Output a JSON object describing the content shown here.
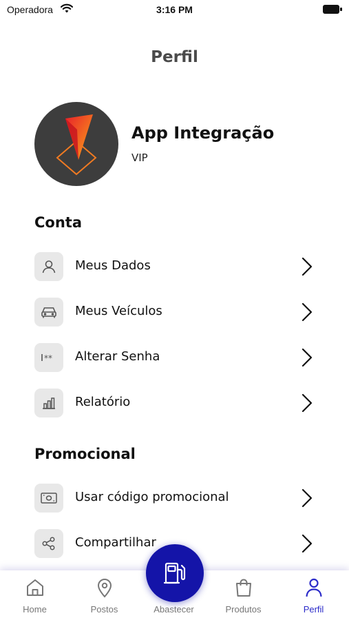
{
  "status_bar": {
    "carrier": "Operadora",
    "time": "3:16 PM"
  },
  "header": {
    "title": "Perfil"
  },
  "profile": {
    "name": "App Integração",
    "level": "VIP"
  },
  "sections": {
    "account": {
      "title": "Conta",
      "items": [
        {
          "label": "Meus Dados",
          "icon": "user-icon"
        },
        {
          "label": "Meus Veículos",
          "icon": "car-icon"
        },
        {
          "label": "Alterar Senha",
          "icon": "password-icon"
        },
        {
          "label": "Relatório",
          "icon": "chart-icon"
        }
      ]
    },
    "promo": {
      "title": "Promocional",
      "items": [
        {
          "label": "Usar código promocional",
          "icon": "ticket-icon"
        },
        {
          "label": "Compartilhar",
          "icon": "share-icon"
        }
      ]
    }
  },
  "tabs": [
    {
      "label": "Home",
      "icon": "home-icon"
    },
    {
      "label": "Postos",
      "icon": "map-pin-icon"
    },
    {
      "label": "Abastecer",
      "icon": "fuel-pump-icon"
    },
    {
      "label": "Produtos",
      "icon": "shopping-bag-icon"
    },
    {
      "label": "Perfil",
      "icon": "person-icon",
      "active": true
    }
  ],
  "colors": {
    "accent": "#2b2bc9",
    "fab": "#1414a8",
    "icon_bg": "#e8e8e8",
    "avatar_bg": "#3d3d3d"
  }
}
